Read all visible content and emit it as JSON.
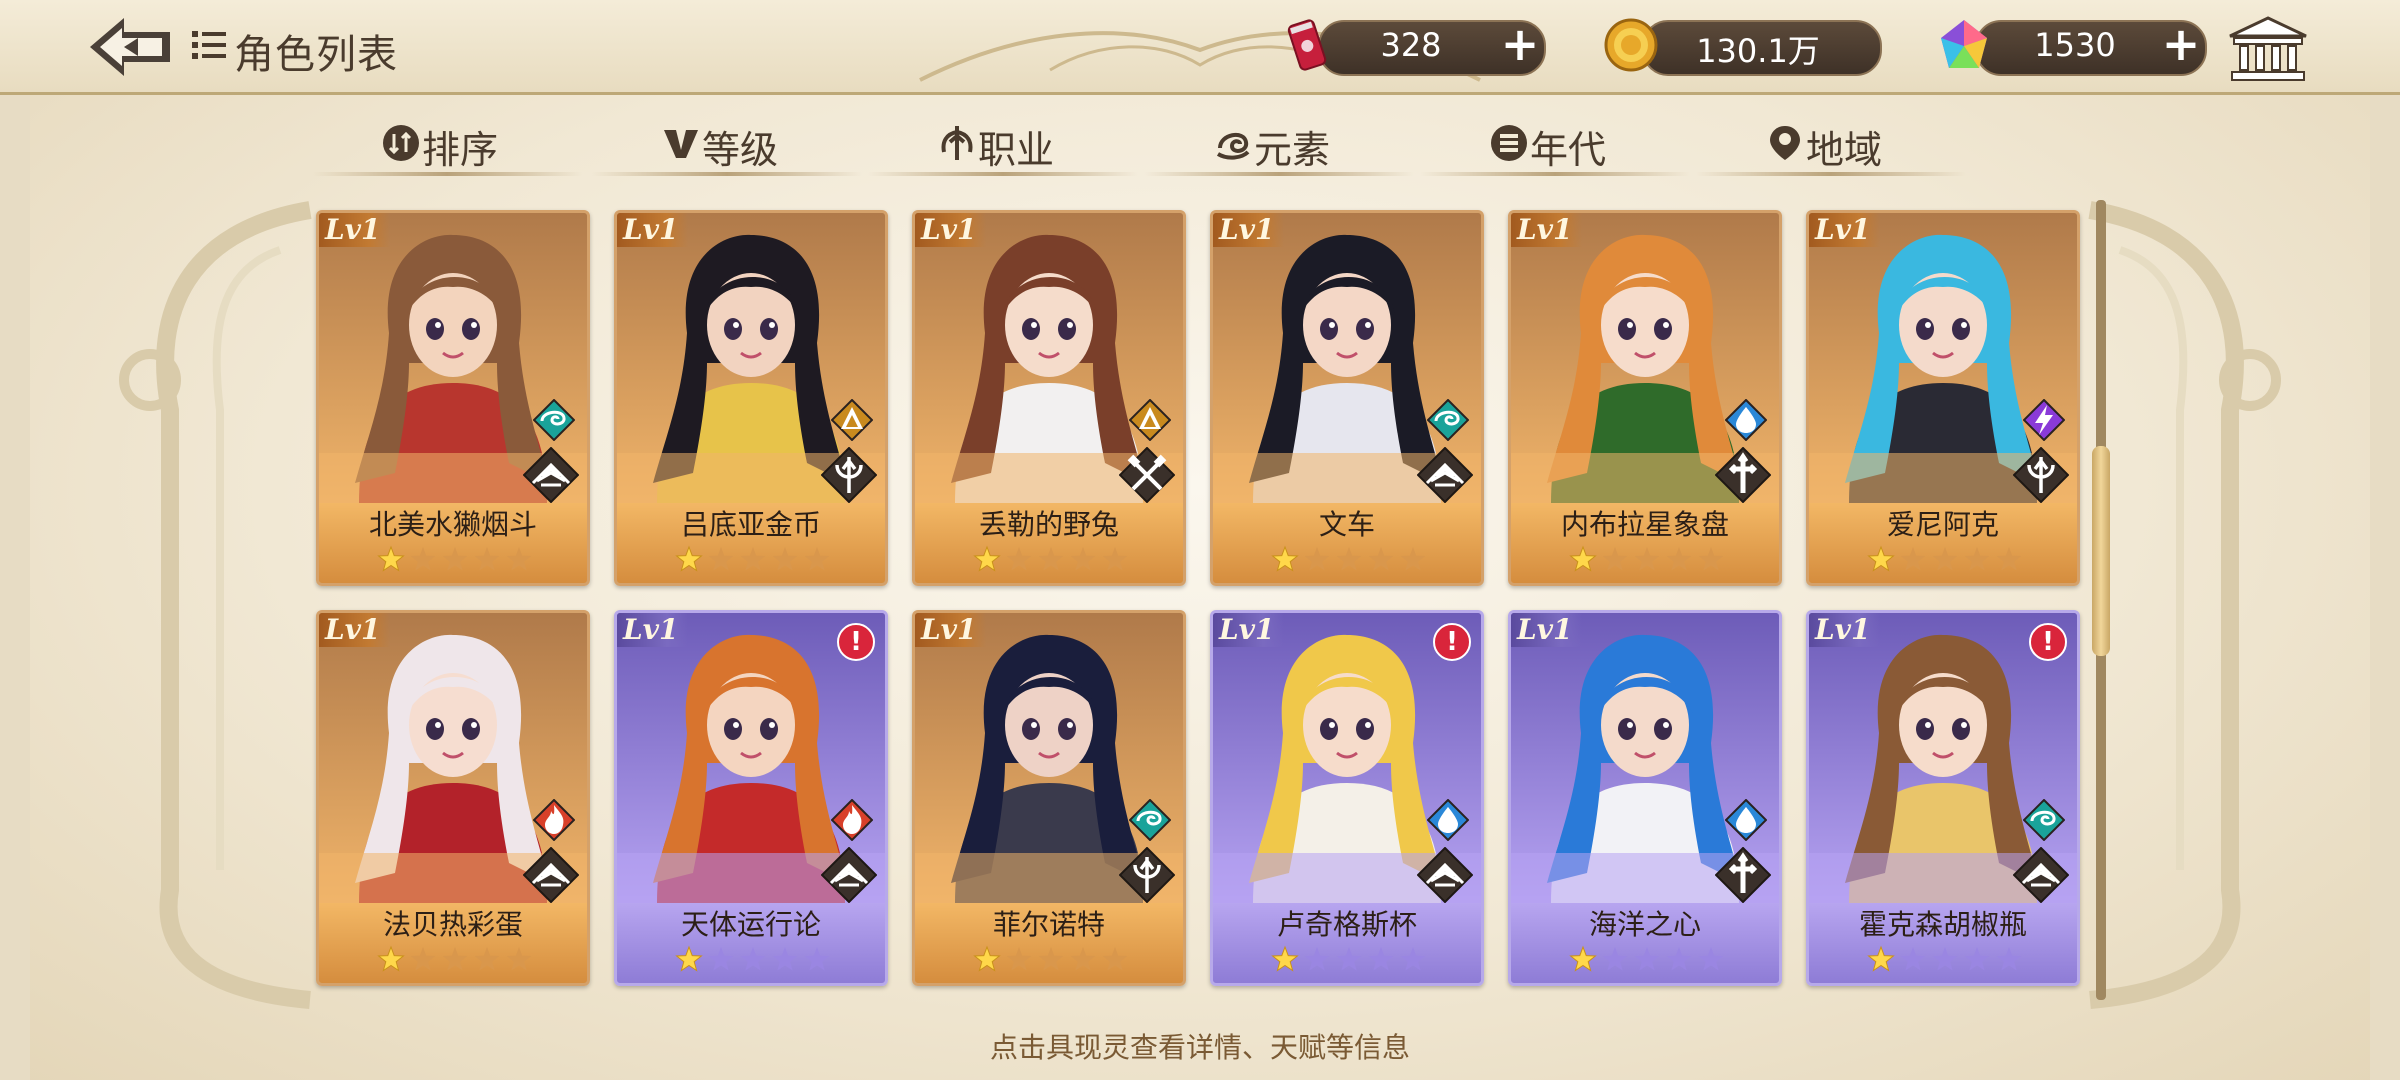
{
  "header": {
    "title": "角色列表",
    "back_icon": "back-arrow-icon",
    "resources": [
      {
        "name": "can-currency",
        "value": "328",
        "icon": "soda-can-icon"
      },
      {
        "name": "gold-coin",
        "value": "130.1万",
        "icon": "gold-coin-icon"
      },
      {
        "name": "crystal",
        "value": "1530",
        "icon": "rainbow-crystal-icon"
      }
    ],
    "museum_icon": "museum-icon"
  },
  "tabs": [
    {
      "label": "排序",
      "icon": "sort-icon"
    },
    {
      "label": "等级",
      "icon": "level-v-icon"
    },
    {
      "label": "职业",
      "icon": "class-icon"
    },
    {
      "label": "元素",
      "icon": "element-swirl-icon"
    },
    {
      "label": "年代",
      "icon": "era-icon"
    },
    {
      "label": "地域",
      "icon": "location-pin-icon"
    }
  ],
  "cards": [
    {
      "level": "Lv1",
      "name": "北美水獭烟斗",
      "rarity": "gold",
      "stars": 1,
      "max_stars": 5,
      "element": "wind",
      "class": "book",
      "alert": false,
      "hair": "#8a5a3a",
      "skin": "#f3d4bd",
      "outfit": "#b8362e"
    },
    {
      "level": "Lv1",
      "name": "吕底亚金币",
      "rarity": "gold",
      "stars": 1,
      "max_stars": 5,
      "element": "earth",
      "class": "trident",
      "alert": false,
      "hair": "#1e1a22",
      "skin": "#f2d3c0",
      "outfit": "#e7c34a"
    },
    {
      "level": "Lv1",
      "name": "丢勒的野兔",
      "rarity": "gold",
      "stars": 1,
      "max_stars": 5,
      "element": "earth",
      "class": "crossed-tools",
      "alert": false,
      "hair": "#7a3f2a",
      "skin": "#f5dccb",
      "outfit": "#f2f0f0"
    },
    {
      "level": "Lv1",
      "name": "文车",
      "rarity": "gold",
      "stars": 1,
      "max_stars": 5,
      "element": "wind",
      "class": "book",
      "alert": false,
      "hair": "#1b1b26",
      "skin": "#f4d7c6",
      "outfit": "#e6e6ee"
    },
    {
      "level": "Lv1",
      "name": "内布拉星象盘",
      "rarity": "gold",
      "stars": 1,
      "max_stars": 5,
      "element": "water",
      "class": "cross",
      "alert": false,
      "hair": "#e08a3a",
      "skin": "#f6dccb",
      "outfit": "#2f6b2a"
    },
    {
      "level": "Lv1",
      "name": "爱尼阿克",
      "rarity": "gold",
      "stars": 1,
      "max_stars": 5,
      "element": "thunder",
      "class": "trident",
      "alert": false,
      "hair": "#3ab8e0",
      "skin": "#f4dacb",
      "outfit": "#2a2a34"
    },
    {
      "level": "Lv1",
      "name": "法贝热彩蛋",
      "rarity": "gold",
      "stars": 1,
      "max_stars": 5,
      "element": "fire",
      "class": "book",
      "alert": false,
      "hair": "#efe6ea",
      "skin": "#f6ddd0",
      "outfit": "#b3222a"
    },
    {
      "level": "Lv1",
      "name": "天体运行论",
      "rarity": "purple",
      "stars": 1,
      "max_stars": 5,
      "element": "fire",
      "class": "book",
      "alert": true,
      "hair": "#d8742e",
      "skin": "#f4d5c0",
      "outfit": "#c42a2a"
    },
    {
      "level": "Lv1",
      "name": "菲尔诺特",
      "rarity": "gold",
      "stars": 1,
      "max_stars": 5,
      "element": "wind",
      "class": "trident",
      "alert": false,
      "hair": "#1a1e3c",
      "skin": "#eed2c6",
      "outfit": "#3a3a4c"
    },
    {
      "level": "Lv1",
      "name": "卢奇格斯杯",
      "rarity": "purple",
      "stars": 1,
      "max_stars": 5,
      "element": "water",
      "class": "book",
      "alert": true,
      "hair": "#f0c84a",
      "skin": "#f6dccb",
      "outfit": "#f4f0e8"
    },
    {
      "level": "Lv1",
      "name": "海洋之心",
      "rarity": "purple",
      "stars": 1,
      "max_stars": 5,
      "element": "water",
      "class": "cross",
      "alert": false,
      "hair": "#2a7ad8",
      "skin": "#f4dacb",
      "outfit": "#f2f2f6"
    },
    {
      "level": "Lv1",
      "name": "霍克森胡椒瓶",
      "rarity": "purple",
      "stars": 1,
      "max_stars": 5,
      "element": "wind",
      "class": "book",
      "alert": true,
      "hair": "#8a5a36",
      "skin": "#f6dccb",
      "outfit": "#e9c56a"
    }
  ],
  "hint": "点击具现灵查看详情、天赋等信息",
  "colors": {
    "gold_card": "#e8a95c",
    "purple_card": "#a997e8",
    "star_on": "#ffd84a",
    "star_off_gold": "#d9974c",
    "star_off_purple": "#9a86e2"
  }
}
